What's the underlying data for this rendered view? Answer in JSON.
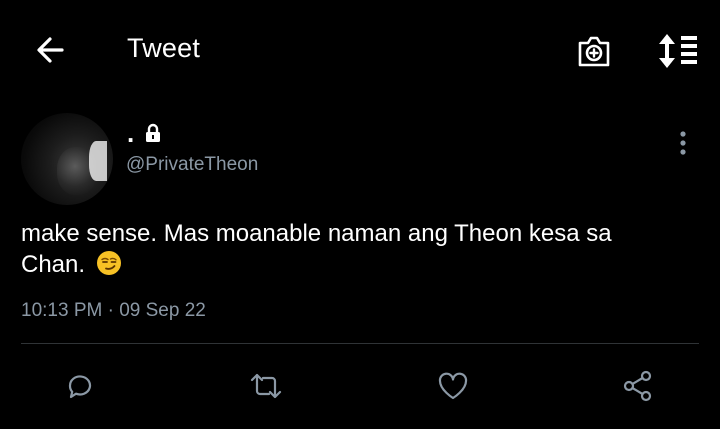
{
  "header": {
    "title": "Tweet",
    "icons": [
      "back-arrow-icon",
      "camera-icon",
      "sort-icon"
    ]
  },
  "tweet": {
    "author_name": ".",
    "handle": "@PrivateTheon",
    "text": "make sense. Mas moanable naman ang Theon kesa sa Chan.",
    "emoji": "smirking-face",
    "timestamp": "10:13 PM · 09 Sep 22"
  },
  "actions": [
    "reply-icon",
    "retweet-icon",
    "like-icon",
    "share-icon"
  ],
  "colors": {
    "background": "#000000",
    "text": "#ffffff",
    "secondary": "#8b98a5",
    "divider": "#2f3336"
  }
}
